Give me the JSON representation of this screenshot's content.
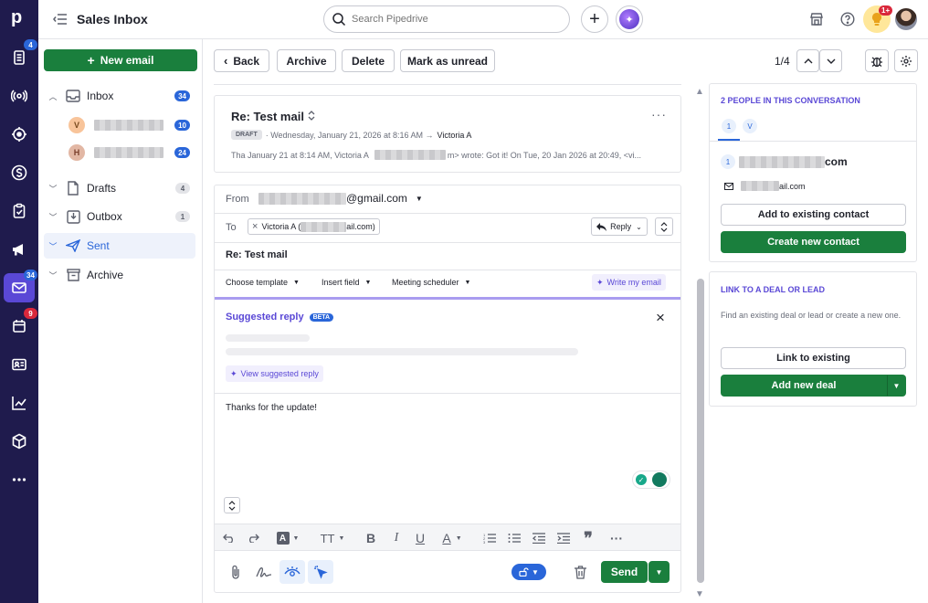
{
  "rail": {
    "logo": "p",
    "items": [
      {
        "name": "deals-icon",
        "badge": "4"
      },
      {
        "name": "leads-icon",
        "badge": ""
      },
      {
        "name": "target-icon",
        "badge": ""
      },
      {
        "name": "dollar-icon",
        "badge": ""
      },
      {
        "name": "tasks-icon",
        "badge": ""
      },
      {
        "name": "campaigns-icon",
        "badge": ""
      },
      {
        "name": "mail-icon",
        "badge": "34"
      },
      {
        "name": "calendar-icon",
        "badge": "9"
      },
      {
        "name": "contacts-icon",
        "badge": ""
      },
      {
        "name": "insights-icon",
        "badge": ""
      },
      {
        "name": "products-icon",
        "badge": ""
      },
      {
        "name": "more-icon",
        "badge": ""
      }
    ]
  },
  "header": {
    "title": "Sales Inbox",
    "search_placeholder": "Search Pipedrive",
    "notif_badge": "1+"
  },
  "sidebar": {
    "new_email": "New email",
    "inbox": {
      "label": "Inbox",
      "count": "34"
    },
    "accounts": [
      {
        "avatar": "V",
        "count": "10"
      },
      {
        "avatar": "H",
        "count": "24"
      }
    ],
    "drafts": {
      "label": "Drafts",
      "count": "4"
    },
    "outbox": {
      "label": "Outbox",
      "count": "1"
    },
    "sent": {
      "label": "Sent"
    },
    "archive": {
      "label": "Archive"
    }
  },
  "toolbar": {
    "back": "Back",
    "archive": "Archive",
    "delete": "Delete",
    "mark_unread": "Mark as unread",
    "pager": "1/4"
  },
  "thread": {
    "subject": "Re: Test mail",
    "draft_badge": "DRAFT",
    "meta_date": "· Wednesday, January 21, 2026 at 8:16 AM →",
    "meta_to": "Victoria A",
    "snippet_prefix": "Tha January 21 at 8:14 AM, Victoria A",
    "snippet_suffix": "m> wrote: Got it! On Tue, 20 Jan 2026 at 20:49, <vi..."
  },
  "composer": {
    "from_label": "From",
    "from_value": "@gmail.com",
    "to_label": "To",
    "to_chip_prefix": "Victoria A (",
    "to_chip_suffix": "ail.com)",
    "reply_mode": "Reply",
    "subject": "Re: Test mail",
    "choose_template": "Choose template",
    "insert_field": "Insert field",
    "meeting_scheduler": "Meeting scheduler",
    "write_my_email": "Write my email",
    "suggested_reply": "Suggested reply",
    "beta": "BETA",
    "view_suggested": "View suggested reply",
    "body": "Thanks for the update!",
    "send": "Send"
  },
  "right_panel": {
    "people_heading": "2 PEOPLE IN THIS CONVERSATION",
    "person_tabs": [
      "1",
      "V"
    ],
    "person_id": "1",
    "person_email_suffix": "com",
    "person_email2_suffix": "ail.com",
    "add_existing": "Add to existing contact",
    "create_contact": "Create new contact",
    "link_heading": "LINK TO A DEAL OR LEAD",
    "link_desc": "Find an existing deal or lead or create a new one.",
    "link_existing": "Link to existing",
    "add_deal": "Add new deal"
  },
  "colors": {
    "rail": "#1f1b4d",
    "green": "#1a7f3d",
    "purple": "#5a48d6",
    "accent_blue": "#2a66d9"
  }
}
